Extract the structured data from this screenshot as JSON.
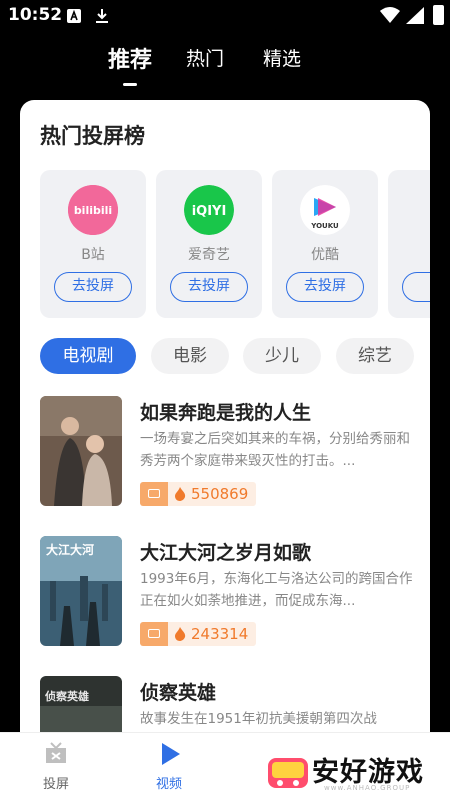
{
  "status_bar": {
    "time": "10:52"
  },
  "top_tabs": [
    "推荐",
    "热门",
    "精选"
  ],
  "section_title": "热门投屏榜",
  "apps": [
    {
      "name": "B站",
      "button": "去投屏",
      "logo_text": "bilibili"
    },
    {
      "name": "爱奇艺",
      "button": "去投屏",
      "logo_text": "iQIYI"
    },
    {
      "name": "优酷",
      "button": "去投屏",
      "logo_text": "YOUKU"
    }
  ],
  "categories": [
    "电视剧",
    "电影",
    "少儿",
    "综艺"
  ],
  "items": [
    {
      "title": "如果奔跑是我的人生",
      "desc": "一场寿宴之后突如其来的车祸，分别给秀丽和秀芳两个家庭带来毁灭性的打击。...",
      "heat": "550869"
    },
    {
      "title": "大江大河之岁月如歌",
      "desc": "1993年6月，东海化工与洛达公司的跨国合作正在如火如荼地推进，而促成东海...",
      "heat": "243314",
      "poster_text": "大江大河"
    },
    {
      "title": "侦察英雄",
      "desc": "故事发生在1951年初抗美援朝第四次战",
      "heat": "",
      "poster_text": "侦察英雄"
    }
  ],
  "bottom_nav": [
    {
      "label": "投屏",
      "icon": "cast-icon"
    },
    {
      "label": "视频",
      "icon": "play-icon"
    }
  ],
  "watermark": {
    "text": "安好游戏",
    "sub": "www.ANHAO.GROUP"
  },
  "colors": {
    "accent": "#2f6fe4",
    "heat": "#f07a2c",
    "heat_bg": "#fdeee3"
  }
}
